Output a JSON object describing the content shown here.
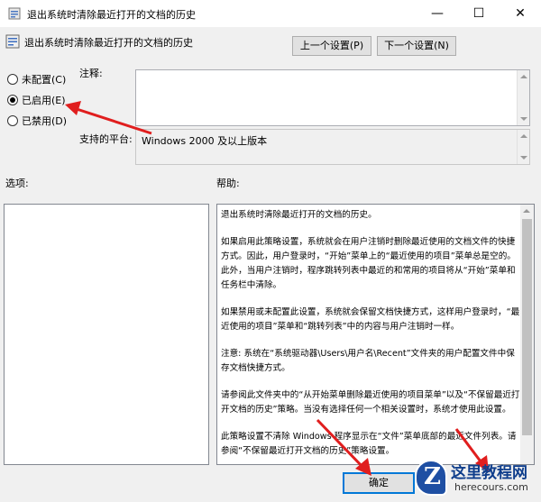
{
  "window": {
    "title": "退出系统时清除最近打开的文档的历史",
    "minimize": "—",
    "maximize": "☐",
    "close": "✕"
  },
  "header": {
    "policy_title": "退出系统时清除最近打开的文档的历史",
    "prev_button": "上一个设置(P)",
    "next_button": "下一个设置(N)"
  },
  "state": {
    "options": [
      {
        "label": "未配置(C)",
        "checked": false
      },
      {
        "label": "已启用(E)",
        "checked": true
      },
      {
        "label": "已禁用(D)",
        "checked": false
      }
    ]
  },
  "fields": {
    "comment_label": "注释:",
    "comment_value": "",
    "platform_label": "支持的平台:",
    "platform_value": "Windows 2000 及以上版本"
  },
  "sections": {
    "options_label": "选项:",
    "help_label": "帮助:"
  },
  "help": {
    "paragraphs": [
      "退出系统时清除最近打开的文档的历史。",
      "如果启用此策略设置，系统就会在用户注销时删除最近使用的文档文件的快捷方式。因此，用户登录时，“开始”菜单上的“最近使用的项目”菜单总是空的。此外，当用户注销时，程序跳转列表中最近的和常用的项目将从“开始”菜单和任务栏中清除。",
      "如果禁用或未配置此设置，系统就会保留文档快捷方式，这样用户登录时，“最近使用的项目”菜单和“跳转列表”中的内容与用户注销时一样。",
      "注意: 系统在“系统驱动器\\Users\\用户名\\Recent”文件夹的用户配置文件中保存文档快捷方式。",
      "请参阅此文件夹中的“从开始菜单删除最近使用的项目菜单”以及“不保留最近打开文档的历史”策略。当没有选择任何一个相关设置时，系统才使用此设置。",
      "此策略设置不清除 Windows 程序显示在“文件”菜单底部的最近文件列表。请参阅“不保留最近打开文档的历史”策略设置。"
    ]
  },
  "footer": {
    "ok_button": "确定"
  },
  "watermark": {
    "letter": "Z",
    "cn": "这里教程网",
    "en": "herecours.com"
  },
  "colors": {
    "arrow": "#e01e1e",
    "ok_border": "#0078d7",
    "logo_blue": "#1e4fa3"
  }
}
